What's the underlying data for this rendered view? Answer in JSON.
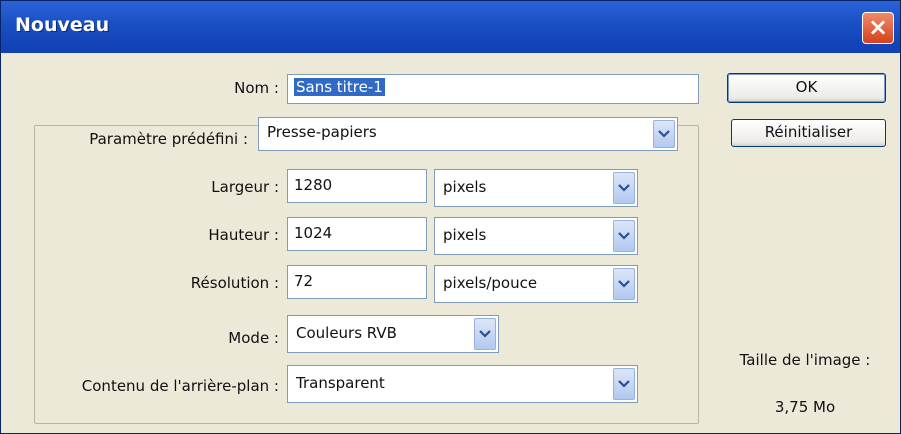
{
  "window": {
    "title": "Nouveau",
    "close_label": "×"
  },
  "form": {
    "name": {
      "label": "Nom :",
      "value": "Sans titre-1"
    },
    "preset": {
      "label": "Paramètre prédéfini :",
      "value": "Presse-papiers"
    },
    "width": {
      "label": "Largeur :",
      "value": "1280",
      "unit": "pixels"
    },
    "height": {
      "label": "Hauteur :",
      "value": "1024",
      "unit": "pixels"
    },
    "resolution": {
      "label": "Résolution :",
      "value": "72",
      "unit": "pixels/pouce"
    },
    "mode": {
      "label": "Mode :",
      "value": "Couleurs RVB"
    },
    "background": {
      "label": "Contenu de l'arrière-plan :",
      "value": "Transparent"
    }
  },
  "buttons": {
    "ok": "OK",
    "reset": "Réinitialiser"
  },
  "image_size": {
    "label": "Taille de l'image :",
    "value": "3,75 Mo"
  },
  "icons": {
    "dropdown": "chevron-down-icon",
    "close": "close-icon"
  }
}
